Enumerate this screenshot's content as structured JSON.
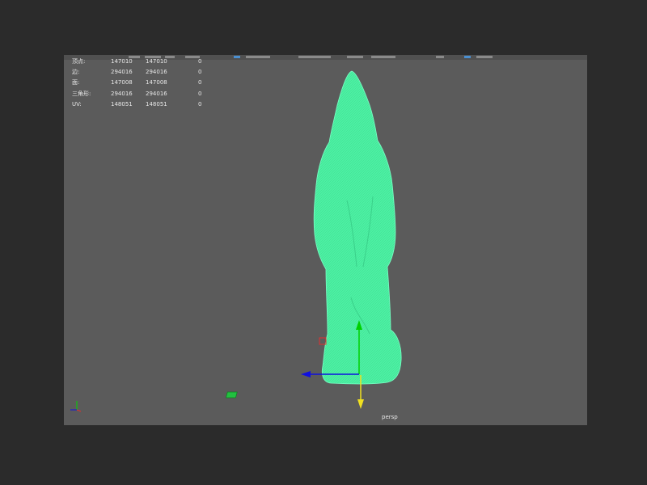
{
  "viewport": {
    "camera_label": "persp",
    "background_color": "#5b5b5b",
    "model_color": "#4cf0a3"
  },
  "hud": {
    "rows": [
      {
        "label": "顶点:",
        "v1": "147010",
        "v2": "147010",
        "v3": "0"
      },
      {
        "label": "边:",
        "v1": "294016",
        "v2": "294016",
        "v3": "0"
      },
      {
        "label": "面:",
        "v1": "147008",
        "v2": "147008",
        "v3": "0"
      },
      {
        "label": "三角形:",
        "v1": "294016",
        "v2": "294016",
        "v3": "0"
      },
      {
        "label": "UV:",
        "v1": "148051",
        "v2": "148051",
        "v3": "0"
      }
    ]
  },
  "manipulator": {
    "x_axis_color": "#1010e0",
    "y_axis_color": "#00d000",
    "z_axis_color": "#f0e020"
  },
  "icons": {
    "view_cube": "axis-indicator-icon",
    "manipulator": "move-manipulator-icon"
  }
}
